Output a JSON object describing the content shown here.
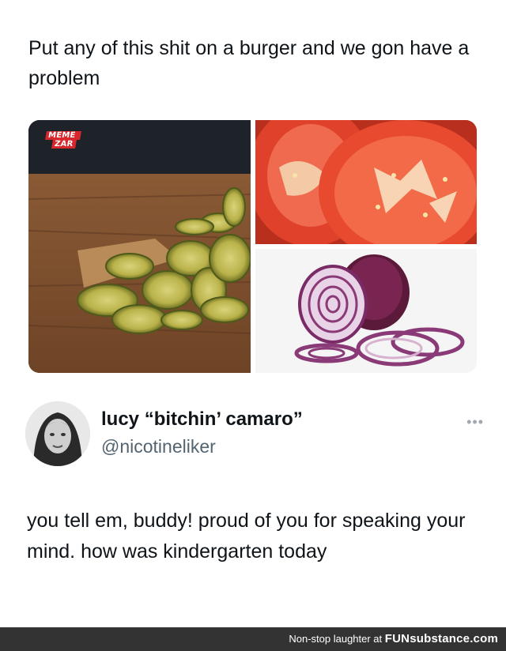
{
  "tweet": {
    "text": "Put any of this shit on a burger and we gon have a problem"
  },
  "media": {
    "watermark_line1": "MEME",
    "watermark_line2": "ZAR",
    "images": [
      "pickles",
      "tomato slices",
      "red onion"
    ]
  },
  "reply": {
    "display_name": "lucy “bitchin’ camaro”",
    "handle": "@nicotineliker",
    "more_label": "•••",
    "text": "you tell em, buddy! proud of you for speaking your mind. how was kindergarten today"
  },
  "footer": {
    "tagline": "Non-stop laughter at ",
    "brand": "FUNsubstance.com"
  },
  "colors": {
    "text": "#0f1419",
    "handle": "#536471",
    "footer_bg": "#333333",
    "watermark": "#d8262d"
  }
}
